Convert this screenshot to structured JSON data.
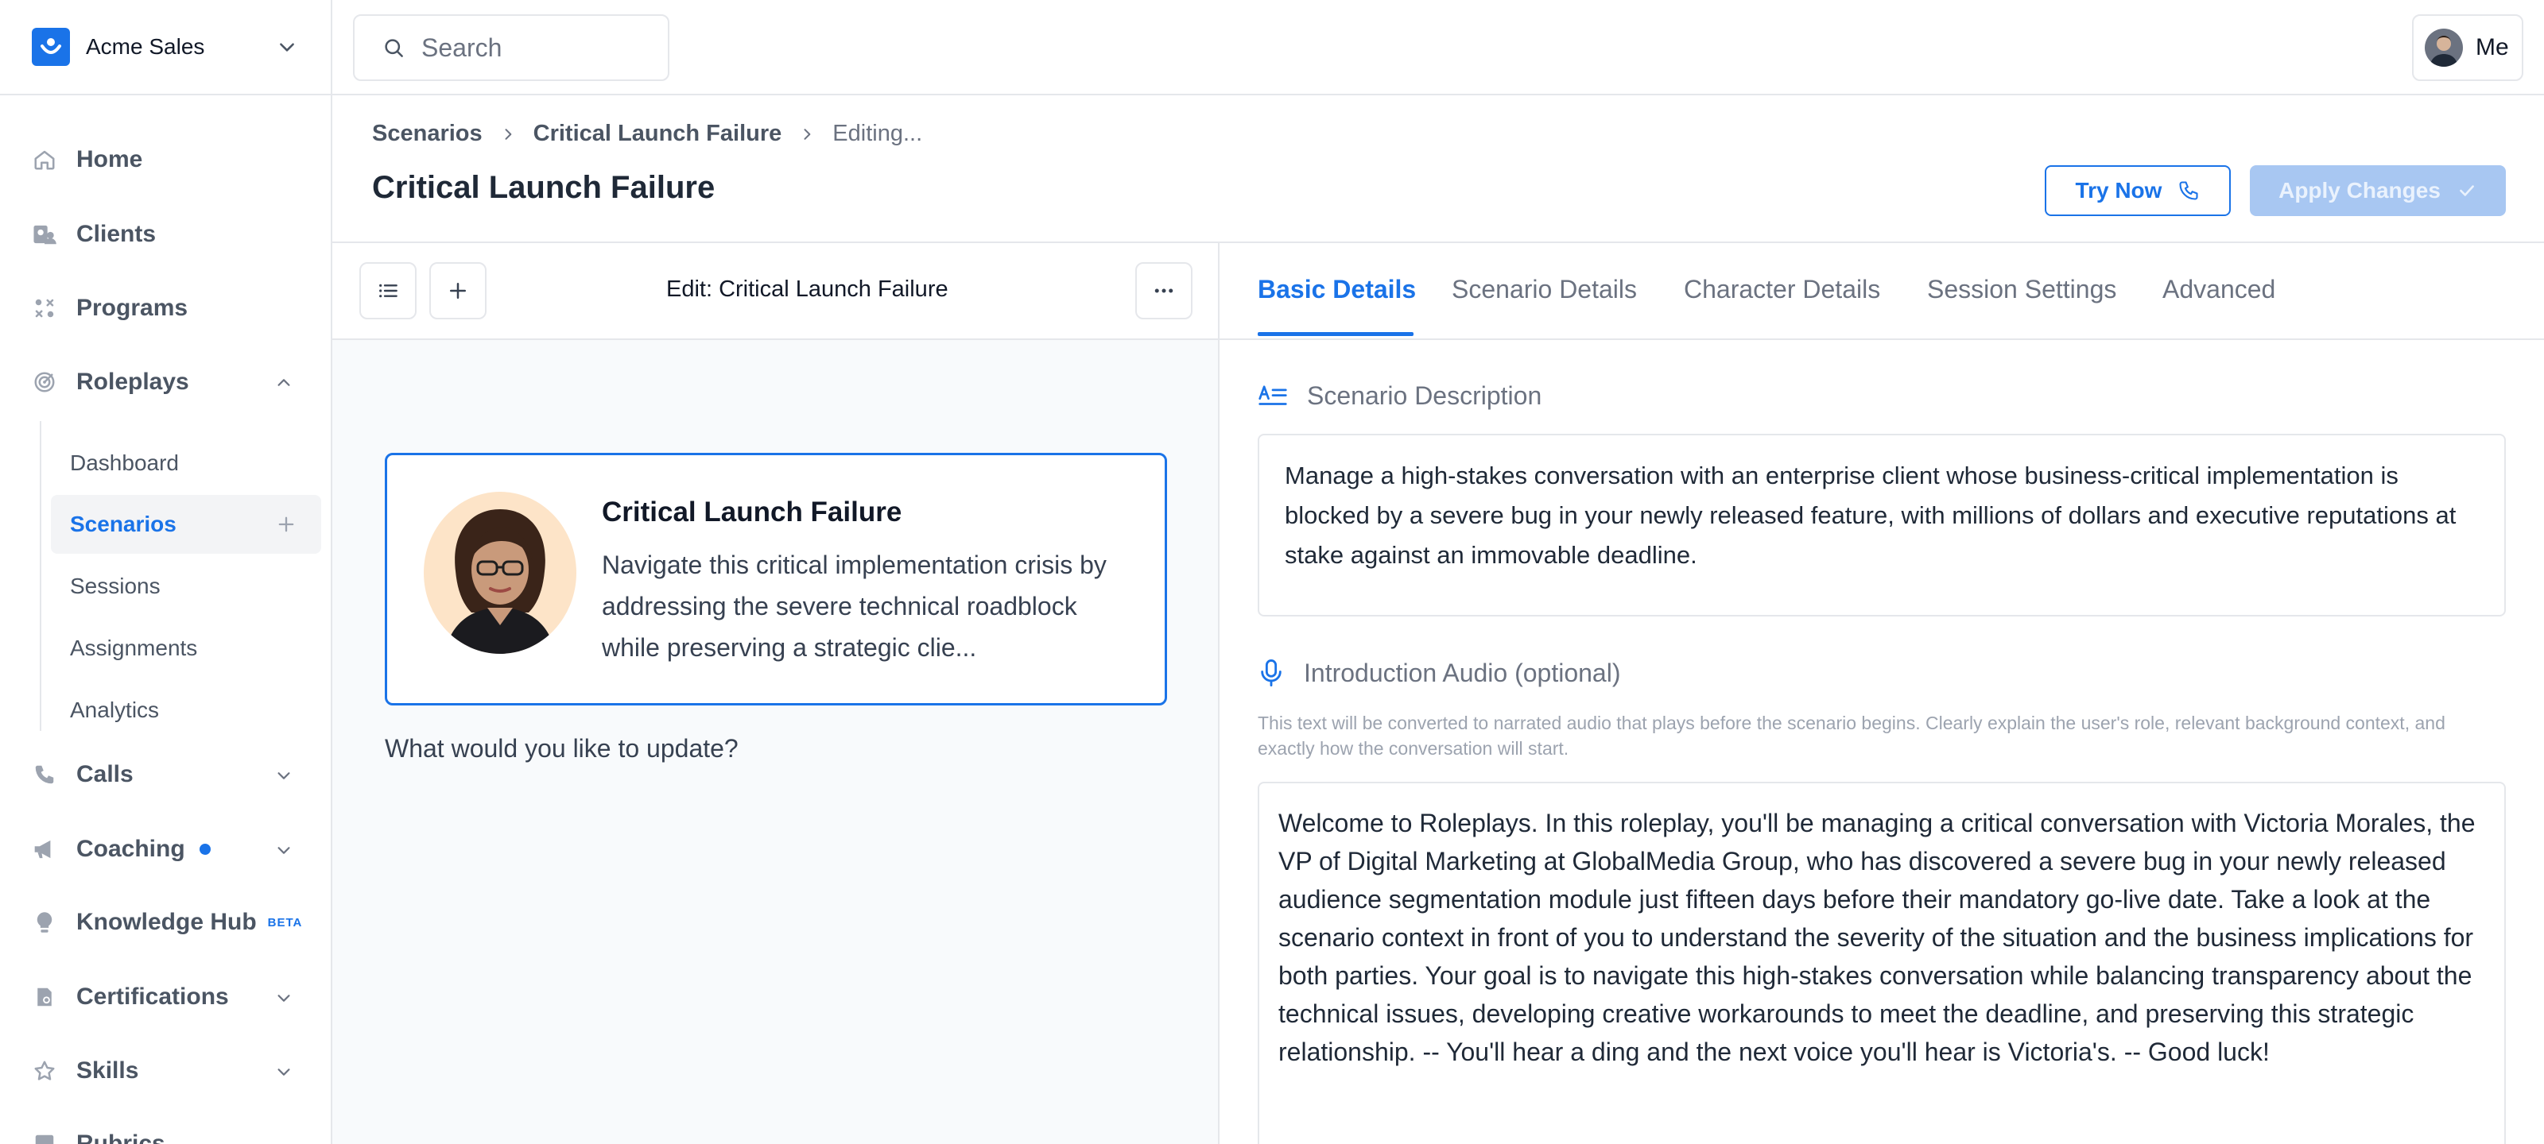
{
  "org": {
    "name": "Acme Sales"
  },
  "search": {
    "placeholder": "Search"
  },
  "user": {
    "label": "Me"
  },
  "sidebar": {
    "items": [
      {
        "label": "Home",
        "icon": "home-icon"
      },
      {
        "label": "Clients",
        "icon": "clients-icon"
      },
      {
        "label": "Programs",
        "icon": "programs-icon"
      },
      {
        "label": "Roleplays",
        "icon": "target-icon"
      },
      {
        "label": "Calls",
        "icon": "phone-icon"
      },
      {
        "label": "Coaching",
        "icon": "megaphone-icon"
      },
      {
        "label": "Knowledge Hub",
        "icon": "lightbulb-icon",
        "badge": "BETA"
      },
      {
        "label": "Certifications",
        "icon": "certificate-icon"
      },
      {
        "label": "Skills",
        "icon": "star-icon"
      },
      {
        "label": "Rubrics",
        "icon": "rubric-icon"
      }
    ],
    "roleplays_sub": [
      "Dashboard",
      "Scenarios",
      "Sessions",
      "Assignments",
      "Analytics"
    ]
  },
  "breadcrumb": [
    "Scenarios",
    "Critical Launch Failure",
    "Editing..."
  ],
  "page": {
    "title": "Critical Launch Failure",
    "try_now": "Try Now",
    "apply_changes": "Apply Changes"
  },
  "editor": {
    "title": "Edit: Critical Launch Failure",
    "card_title": "Critical Launch Failure",
    "card_desc": "Navigate this critical implementation crisis by addressing the severe technical roadblock while preserving a strategic clie...",
    "prompt": "What would you like to update?"
  },
  "tabs": [
    "Basic Details",
    "Scenario Details",
    "Character Details",
    "Session Settings",
    "Advanced"
  ],
  "details": {
    "desc_label": "Scenario Description",
    "desc_text": "Manage a high-stakes conversation with an enterprise client whose business-critical implementation is blocked by a severe bug in your newly released feature, with millions of dollars and executive reputations at stake against an immovable deadline.",
    "audio_label": "Introduction Audio (optional)",
    "audio_hint": "This text will be converted to narrated audio that plays before the scenario begins. Clearly explain the user's role, relevant background context, and exactly how the conversation will start.",
    "audio_text": "Welcome to Roleplays. In this roleplay, you'll be managing a critical conversation with Victoria Morales, the VP of Digital Marketing at GlobalMedia Group, who has discovered a severe bug in your newly released audience segmentation module just fifteen days before their mandatory go-live date. Take a look at the scenario context in front of you to understand the severity of the situation and the business implications for both parties. Your goal is to navigate this high-stakes conversation while balancing transparency about the technical issues, developing creative workarounds to meet the deadline, and preserving this strategic relationship. -- You'll hear a ding and the next voice you'll hear is Victoria's. -- Good luck!"
  },
  "colors": {
    "accent": "#1a73e8",
    "apply_disabled": "#a8c7f2",
    "notification_dot": "#1a73e8"
  }
}
